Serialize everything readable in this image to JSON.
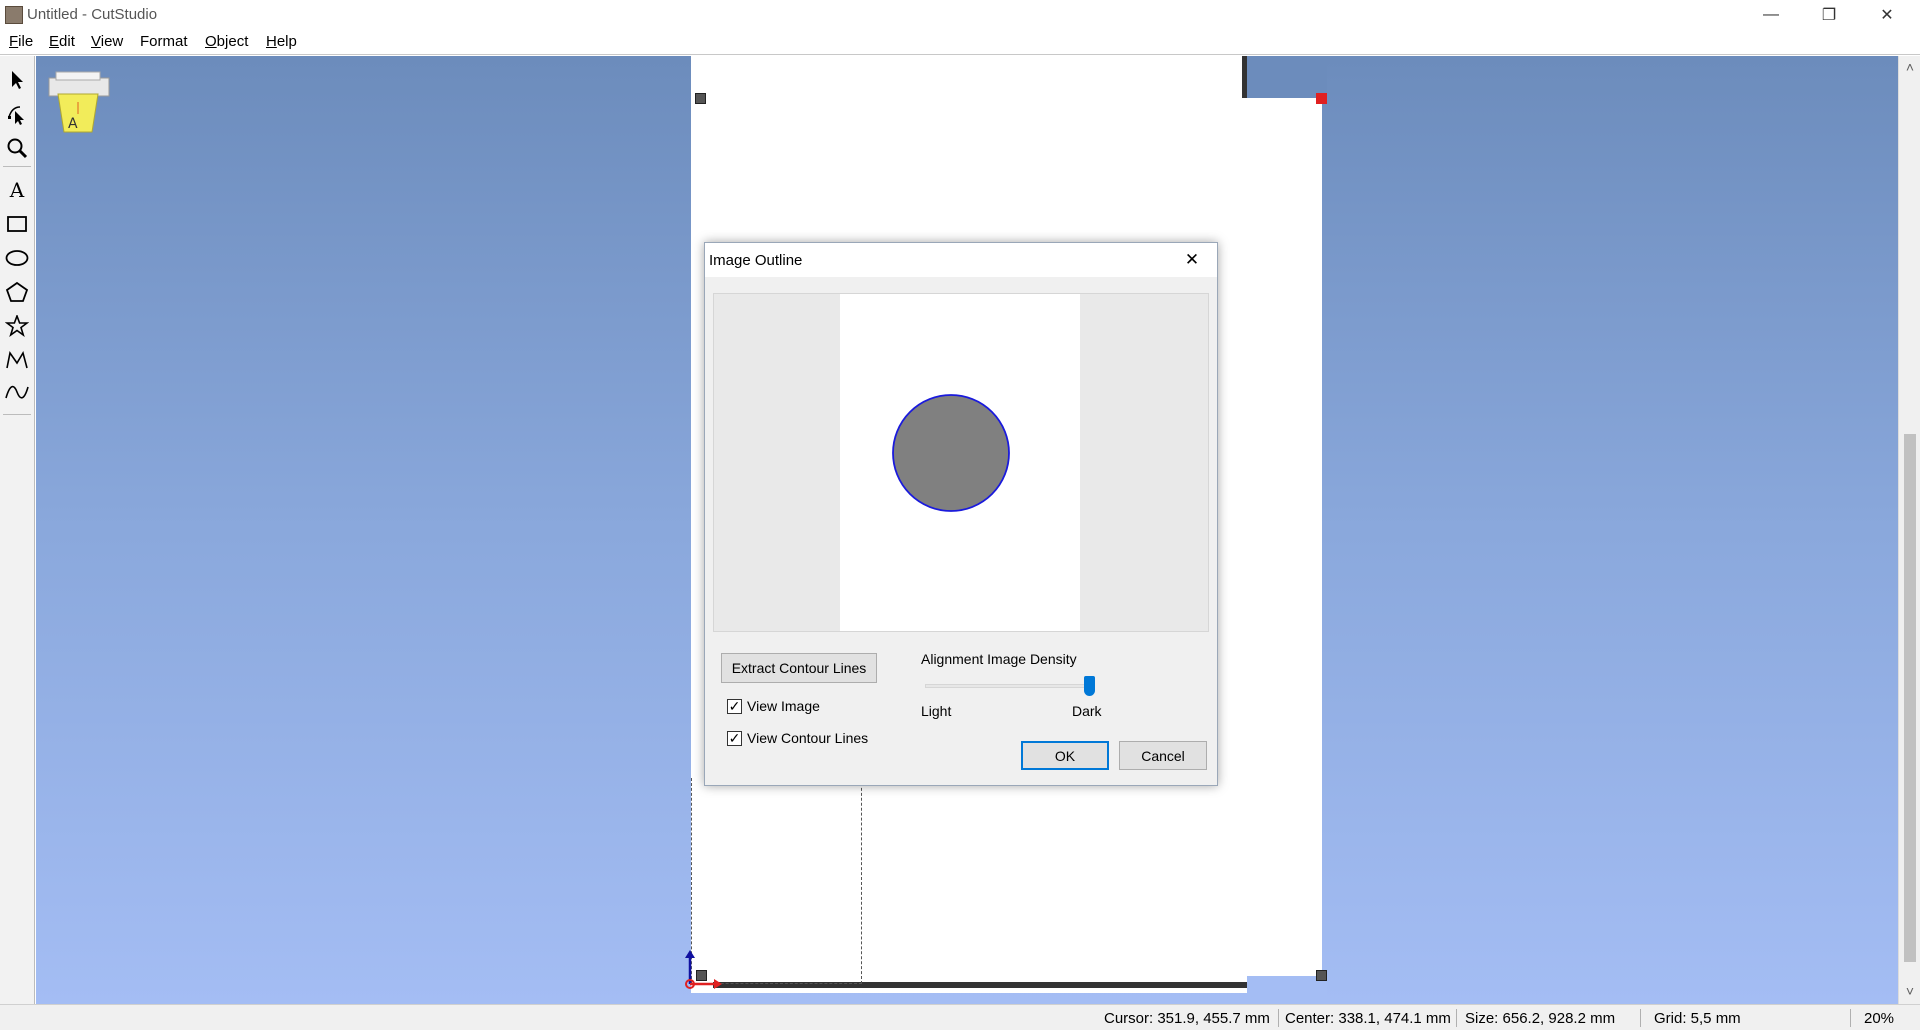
{
  "window": {
    "title": "Untitled - CutStudio",
    "minimize_glyph": "—",
    "restore_glyph": "❐",
    "close_glyph": "✕"
  },
  "menu": {
    "items": [
      {
        "label": "File",
        "u": "F",
        "rest": "ile"
      },
      {
        "label": "Edit",
        "u": "E",
        "rest": "dit"
      },
      {
        "label": "View",
        "u": "V",
        "rest": "iew"
      },
      {
        "label": "Format",
        "u": "",
        "rest": "Format"
      },
      {
        "label": "Object",
        "u": "O",
        "rest": "bject"
      },
      {
        "label": "Help",
        "u": "H",
        "rest": "elp"
      }
    ]
  },
  "toolbox": {
    "tools": [
      "select-tool",
      "edit-points-tool",
      "zoom-tool",
      "text-tool",
      "rectangle-tool",
      "ellipse-tool",
      "polygon-tool",
      "star-tool",
      "polyline-tool",
      "freehand-tool"
    ],
    "text_glyph": "A"
  },
  "dialog": {
    "title": "Image Outline",
    "extract_button": "Extract Contour Lines",
    "view_image_label": "View Image",
    "view_image_checked": true,
    "view_contour_label": "View Contour Lines",
    "view_contour_checked": true,
    "density_label": "Alignment Image Density",
    "density_light": "Light",
    "density_dark": "Dark",
    "density_value": 1.0,
    "ok_label": "OK",
    "cancel_label": "Cancel",
    "check_glyph": "✓",
    "close_glyph": "✕"
  },
  "status": {
    "cursor": "Cursor: 351.9, 455.7 mm",
    "center": "Center: 338.1, 474.1 mm",
    "size": "Size: 656.2, 928.2 mm",
    "grid": "Grid: 5,5 mm",
    "zoom": "20%"
  },
  "colors": {
    "accent": "#0078d7",
    "canvas_top": "#6c8cbc",
    "canvas_bottom": "#a4bdf4",
    "handle_red": "#e02020",
    "contour_blue": "#1a1adc",
    "circle_fill": "#808080"
  }
}
